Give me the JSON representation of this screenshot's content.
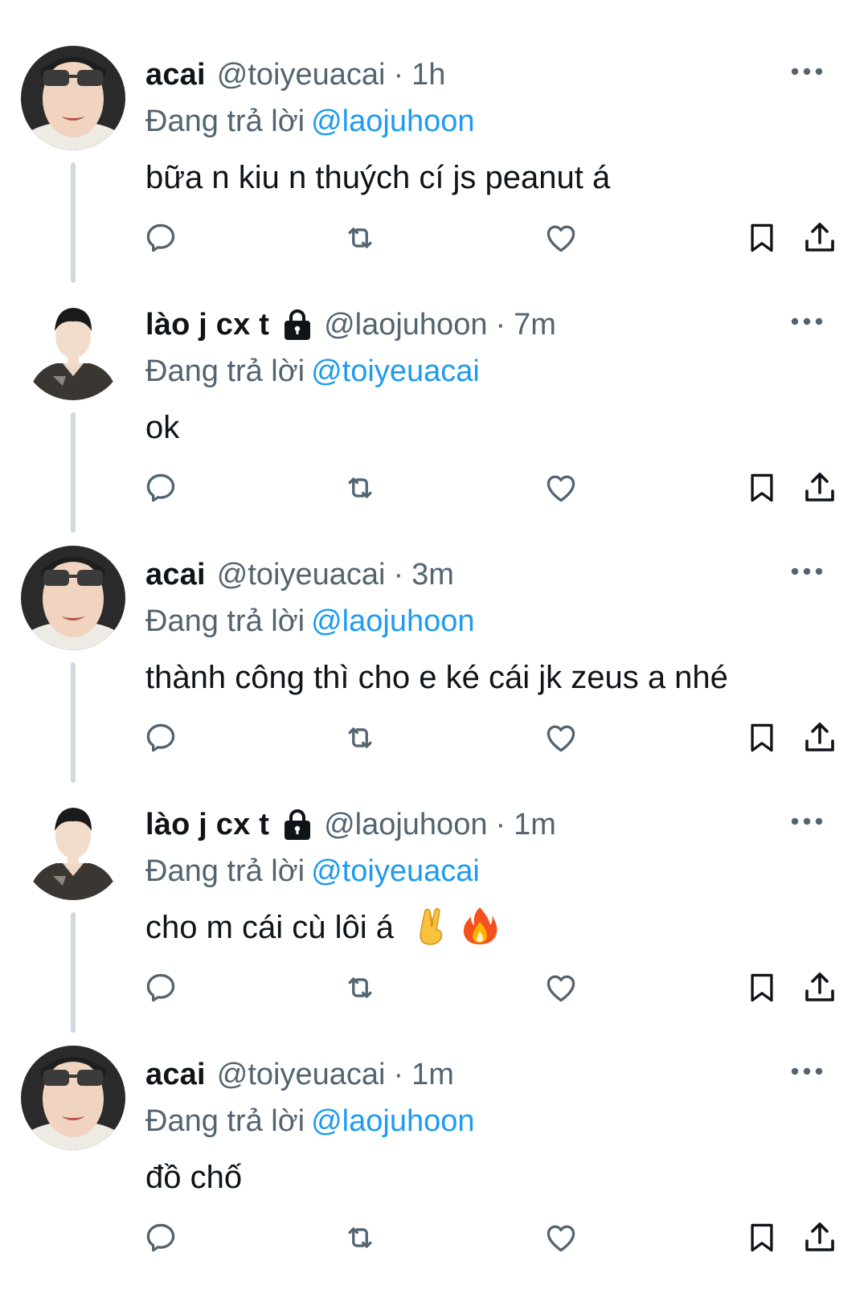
{
  "colors": {
    "text": "#0f1419",
    "secondary": "#536471",
    "link": "#1d9bf0",
    "thread_line": "#cfd9de"
  },
  "tweets": [
    {
      "display_name": "acai",
      "handle": "@toiyeuacai",
      "separator": "·",
      "time": "1h",
      "locked": false,
      "reply_prefix": "Đang trả lời",
      "reply_to": "@laojuhoon",
      "text": "bữa n kiu n thuých cí js peanut á",
      "emojis": []
    },
    {
      "display_name": "lào j cx t",
      "handle": "@laojuhoon",
      "separator": "·",
      "time": "7m",
      "locked": true,
      "reply_prefix": "Đang trả lời",
      "reply_to": "@toiyeuacai",
      "text": "ok",
      "emojis": []
    },
    {
      "display_name": "acai",
      "handle": "@toiyeuacai",
      "separator": "·",
      "time": "3m",
      "locked": false,
      "reply_prefix": "Đang trả lời",
      "reply_to": "@laojuhoon",
      "text": "thành công thì cho e ké cái jk zeus a nhé",
      "emojis": []
    },
    {
      "display_name": "lào j cx t",
      "handle": "@laojuhoon",
      "separator": "·",
      "time": "1m",
      "locked": true,
      "reply_prefix": "Đang trả lời",
      "reply_to": "@toiyeuacai",
      "text": "cho m cái cù lôi á",
      "emojis": [
        "crossed-fingers-emoji",
        "fire-emoji"
      ]
    },
    {
      "display_name": "acai",
      "handle": "@toiyeuacai",
      "separator": "·",
      "time": "1m",
      "locked": false,
      "reply_prefix": "Đang trả lời",
      "reply_to": "@laojuhoon",
      "text": "đồ chố",
      "emojis": []
    }
  ],
  "action_icons": [
    "reply-icon",
    "retweet-icon",
    "like-icon",
    "bookmark-icon",
    "share-icon"
  ]
}
